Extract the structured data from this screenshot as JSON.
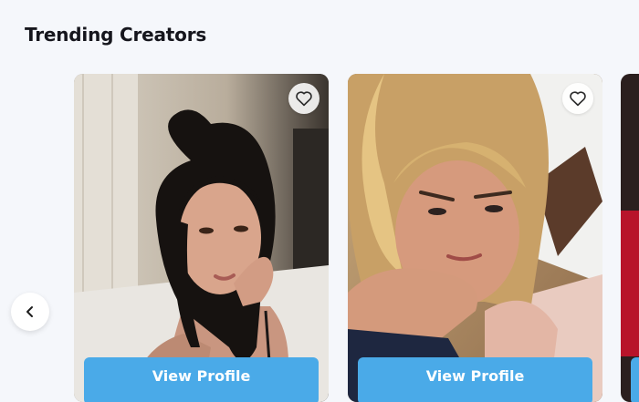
{
  "section": {
    "title": "Trending Creators"
  },
  "carousel": {
    "prev_icon": "chevron-left-icon",
    "favorite_icon": "heart-outline-icon",
    "accent_color": "#4aaae8",
    "cards": [
      {
        "button_label": "View Profile"
      },
      {
        "button_label": "View Profile"
      }
    ]
  }
}
